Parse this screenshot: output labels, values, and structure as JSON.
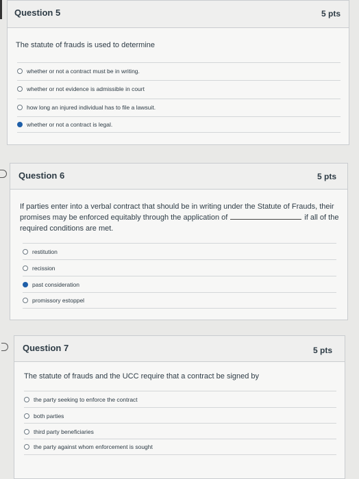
{
  "questions": [
    {
      "title": "Question 5",
      "points": "5 pts",
      "text": "The statute of frauds is used to determine",
      "answers": [
        {
          "label": "whether or not a contract must be in writing.",
          "selected": false
        },
        {
          "label": "whether or not evidence is admissible in court",
          "selected": false
        },
        {
          "label": "how long an injured individual has to file a lawsuit.",
          "selected": false
        },
        {
          "label": "whether or not a contract is legal.",
          "selected": true
        }
      ]
    },
    {
      "title": "Question 6",
      "points": "5 pts",
      "text_line1": "If parties enter into a verbal contract that should be in writing under the Statute of Frauds, their",
      "text_line2a": "promises may be enforced equitably through the application of",
      "text_line2b": "if all of the",
      "text_line3": "required conditions are met.",
      "answers": [
        {
          "label": "restitution",
          "selected": false
        },
        {
          "label": "recission",
          "selected": false
        },
        {
          "label": "past consideration",
          "selected": true
        },
        {
          "label": "promissory estoppel",
          "selected": false
        }
      ]
    },
    {
      "title": "Question 7",
      "points": "5 pts",
      "text": "The statute of frauds and the UCC require that a contract be signed by",
      "answers": [
        {
          "label": "the party seeking to enforce the contract",
          "selected": false
        },
        {
          "label": "both parties",
          "selected": false
        },
        {
          "label": "third party beneficiaries",
          "selected": false
        },
        {
          "label": "the party against whom enforcement is sought",
          "selected": false
        }
      ]
    }
  ]
}
